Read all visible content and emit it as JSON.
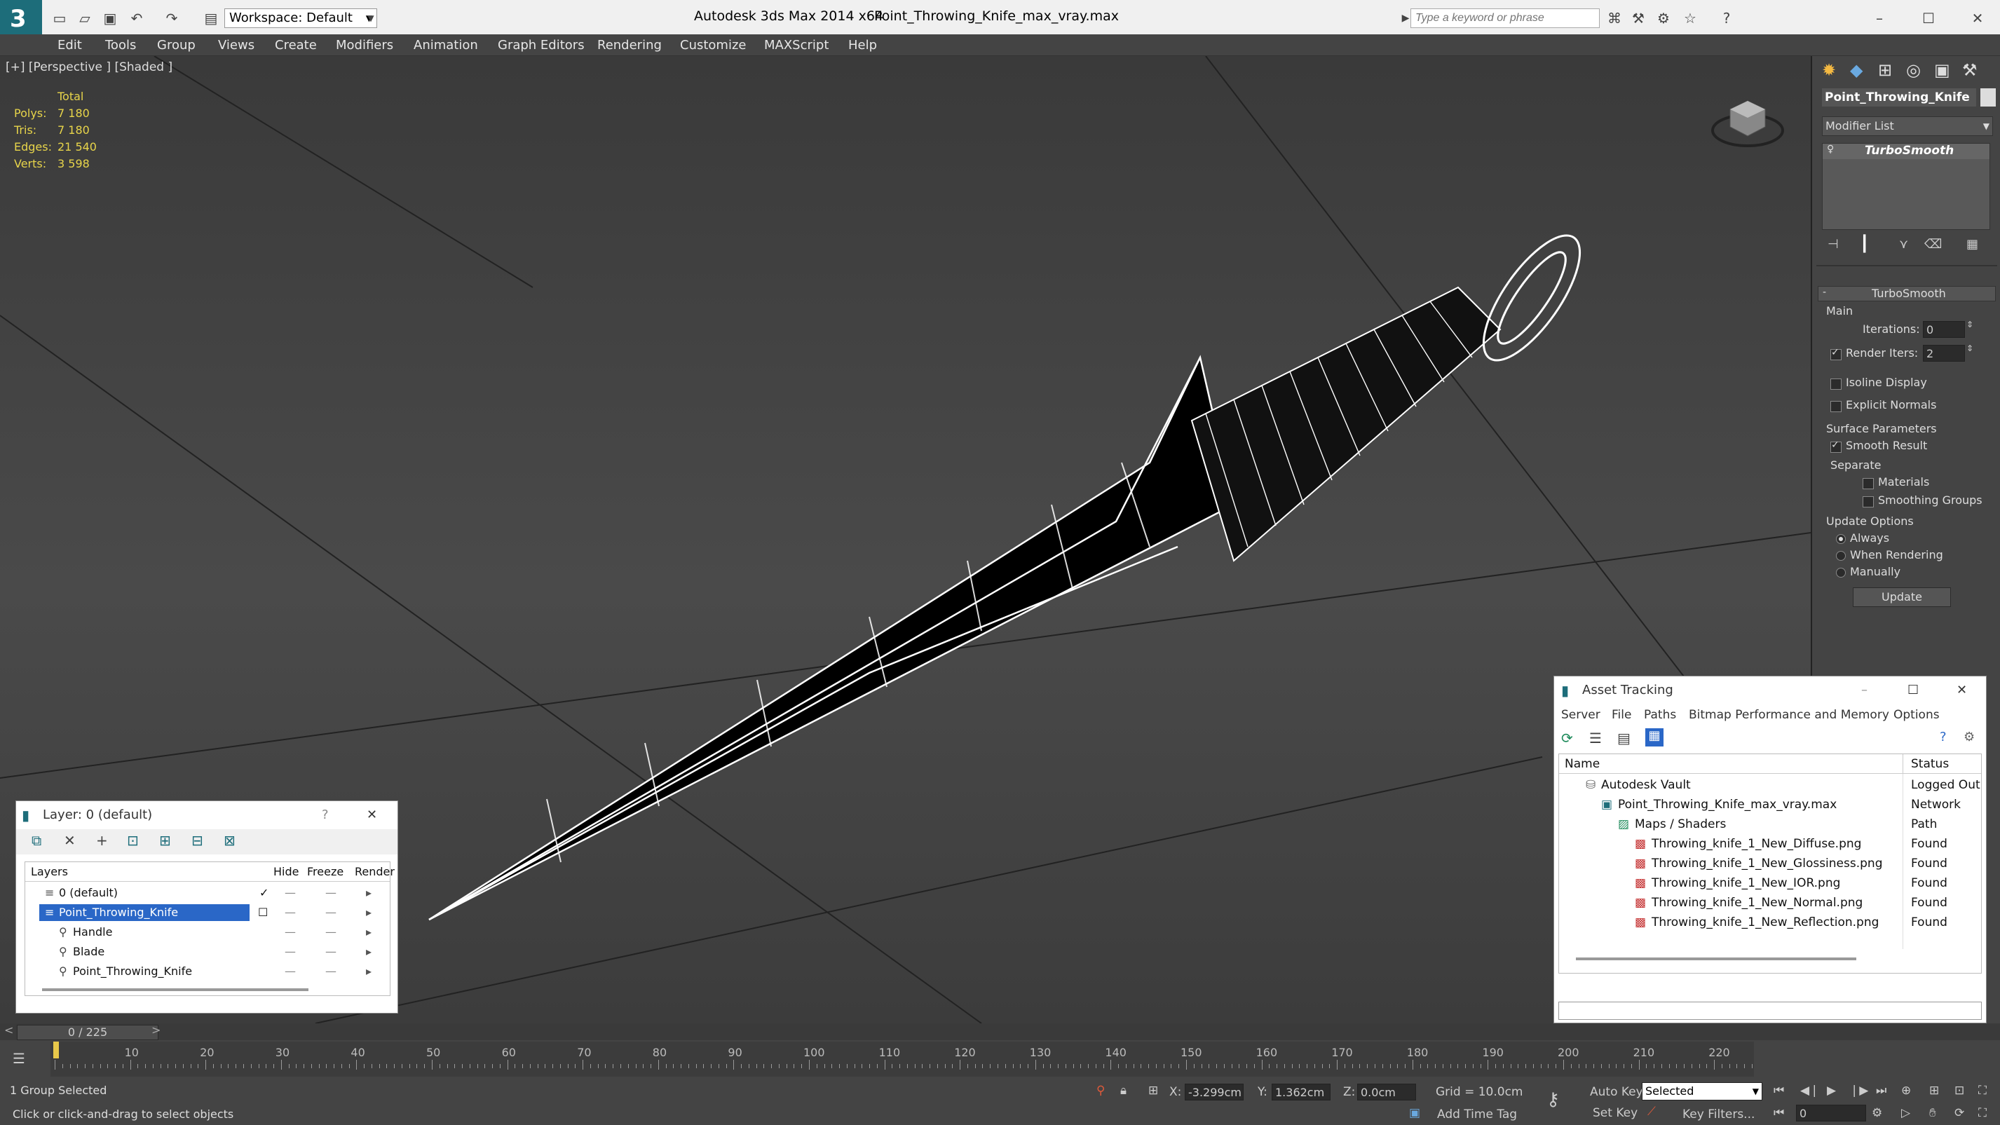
{
  "title_bar": {
    "workspace": "Workspace: Default",
    "app": "Autodesk 3ds Max  2014 x64",
    "file": "Point_Throwing_Knife_max_vray.max",
    "search_placeholder": "Type a keyword or phrase"
  },
  "menu": [
    "Edit",
    "Tools",
    "Group",
    "Views",
    "Create",
    "Modifiers",
    "Animation",
    "Graph Editors",
    "Rendering",
    "Customize",
    "MAXScript",
    "Help"
  ],
  "viewport": {
    "label": "[+] [Perspective ] [Shaded ]",
    "stats": {
      "header": "Total",
      "rows": [
        {
          "label": "Polys:",
          "value": "7 180"
        },
        {
          "label": "Tris:",
          "value": "7 180"
        },
        {
          "label": "Edges:",
          "value": "21 540"
        },
        {
          "label": "Verts:",
          "value": "3 598"
        }
      ]
    }
  },
  "command_panel": {
    "object_name": "Point_Throwing_Knife",
    "modifier_list": "Modifier List",
    "stack_item": "TurboSmooth",
    "rollout_title": "TurboSmooth",
    "main_group": "Main",
    "iterations_label": "Iterations:",
    "iterations_value": "0",
    "render_iters_label": "Render Iters:",
    "render_iters_value": "2",
    "isoline_display": "Isoline Display",
    "explicit_normals": "Explicit Normals",
    "surface_parameters": "Surface Parameters",
    "smooth_result": "Smooth Result",
    "separate": "Separate",
    "materials": "Materials",
    "smoothing_groups": "Smoothing Groups",
    "update_options": "Update Options",
    "always": "Always",
    "when_rendering": "When Rendering",
    "manually": "Manually",
    "update_button": "Update"
  },
  "layer_dialog": {
    "title": "Layer: 0 (default)",
    "help": "?",
    "columns": {
      "layers": "Layers",
      "hide": "Hide",
      "freeze": "Freeze",
      "render": "Render"
    },
    "rows": [
      {
        "name": "0 (default)"
      },
      {
        "name": "Point_Throwing_Knife"
      },
      {
        "name": "Handle"
      },
      {
        "name": "Blade"
      },
      {
        "name": "Point_Throwing_Knife"
      }
    ]
  },
  "asset_tracking": {
    "title": "Asset Tracking",
    "menu": [
      "Server",
      "File",
      "Paths",
      "Bitmap Performance and Memory",
      "Options"
    ],
    "columns": {
      "name": "Name",
      "status": "Status"
    },
    "rows": [
      {
        "name": "Autodesk Vault",
        "status": "Logged Out ."
      },
      {
        "name": "Point_Throwing_Knife_max_vray.max",
        "status": "Network Path"
      },
      {
        "name": "Maps / Shaders",
        "status": ""
      },
      {
        "name": "Throwing_knife_1_New_Diffuse.png",
        "status": "Found"
      },
      {
        "name": "Throwing_knife_1_New_Glossiness.png",
        "status": "Found"
      },
      {
        "name": "Throwing_knife_1_New_IOR.png",
        "status": "Found"
      },
      {
        "name": "Throwing_knife_1_New_Normal.png",
        "status": "Found"
      },
      {
        "name": "Throwing_knife_1_New_Reflection.png",
        "status": "Found"
      }
    ]
  },
  "timeline": {
    "frame": "0 / 225",
    "ticks": [
      "10",
      "20",
      "30",
      "40",
      "50",
      "60",
      "70",
      "80",
      "90",
      "100",
      "110",
      "120",
      "130",
      "140",
      "150",
      "160",
      "170",
      "180",
      "190",
      "200",
      "210",
      "220"
    ]
  },
  "status": {
    "selection": "1 Group Selected",
    "prompt": "Click or click-and-drag to select objects",
    "x_label": "X:",
    "x_value": "-3.299cm",
    "y_label": "Y:",
    "y_value": "1.362cm",
    "z_label": "Z:",
    "z_value": "0.0cm",
    "grid": "Grid = 10.0cm",
    "auto_key": "Auto Key",
    "selected": "Selected",
    "set_key": "Set Key",
    "key_filters": "Key Filters...",
    "add_time_tag": "Add Time Tag",
    "frame_field": "0"
  }
}
